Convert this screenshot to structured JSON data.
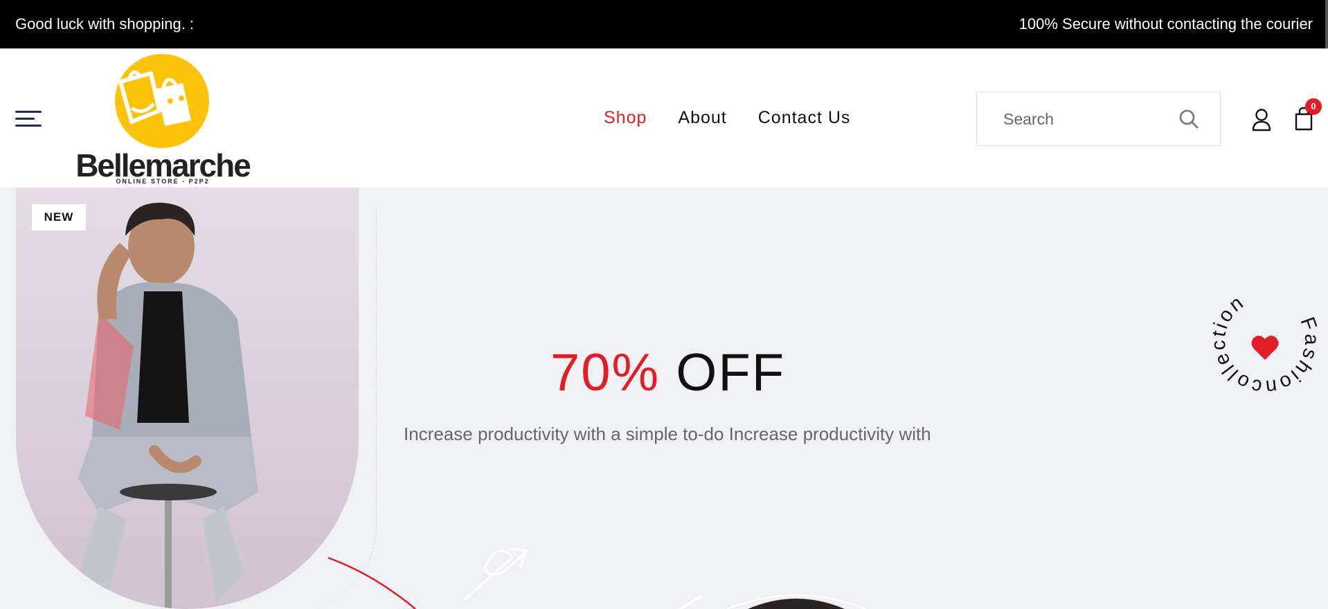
{
  "topbar": {
    "left_text": "Good luck with shopping. :",
    "right_text": "100% Secure without contacting the courier"
  },
  "header": {
    "logo": {
      "brand": "Bellemarche",
      "tagline": "ONLINE STORE - P2P2"
    },
    "nav": [
      {
        "label": "Shop",
        "active": true
      },
      {
        "label": "About",
        "active": false
      },
      {
        "label": "Contact Us",
        "active": false
      }
    ],
    "search": {
      "placeholder": "Search",
      "icon": "search-icon"
    },
    "cart_count": "0",
    "icons": [
      "menu-icon",
      "user-icon",
      "shopping-bag-icon"
    ],
    "accent_color": "#e11d25"
  },
  "hero": {
    "badge": "NEW",
    "discount": "70%",
    "discount_suffix": "OFF",
    "subtext": "Increase productivity with a simple to-do Increase productivity with",
    "ring_text": "Fashioncollection ",
    "ring_icon": "heart-icon"
  }
}
